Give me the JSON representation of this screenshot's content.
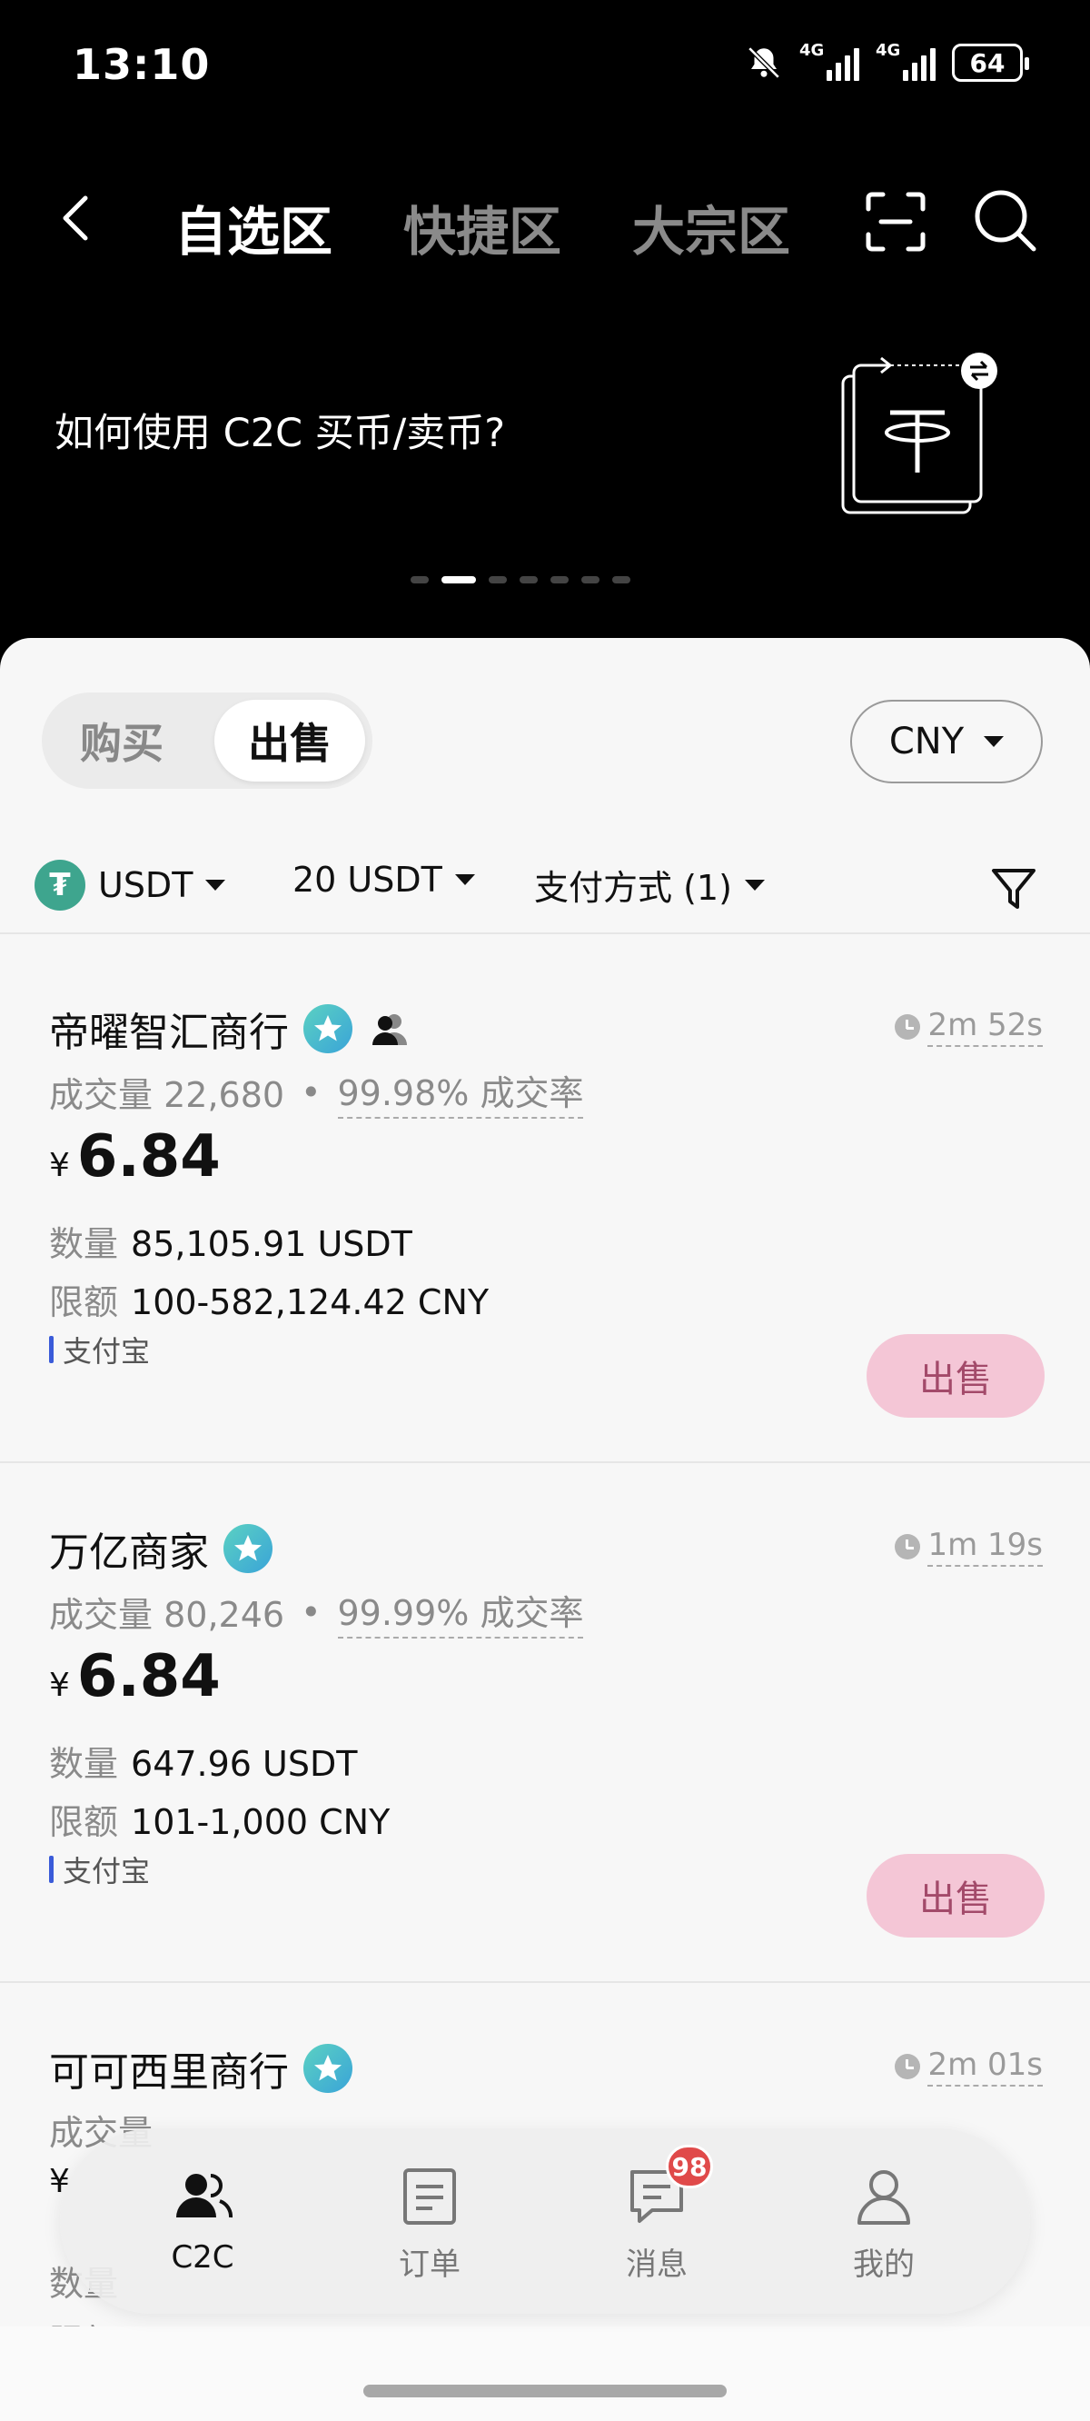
{
  "status_bar": {
    "time": "13:10",
    "network1": "4G",
    "network2": "4G",
    "battery": "64"
  },
  "header": {
    "tabs": [
      {
        "label": "自选区",
        "active": true
      },
      {
        "label": "快捷区",
        "active": false
      },
      {
        "label": "大宗区",
        "active": false
      }
    ]
  },
  "banner": {
    "text": "如何使用 C2C 买币/卖币?",
    "page_count": 7,
    "active_page": 2
  },
  "trade_toggle": {
    "buy": "购买",
    "sell": "出售",
    "selected": "sell"
  },
  "currency": {
    "value": "CNY"
  },
  "filters": {
    "coin": "USDT",
    "coin_symbol": "₮",
    "amount": "20 USDT",
    "payment": "支付方式 (1)"
  },
  "listings": [
    {
      "merchant": "帝曜智汇商行",
      "timer": "2m 52s",
      "volume_label": "成交量",
      "volume": "22,680",
      "rate": "99.98% 成交率",
      "currency_symbol": "¥",
      "price": "6.84",
      "qty_label": "数量",
      "qty": "85,105.91 USDT",
      "limit_label": "限额",
      "limit": "100-582,124.42 CNY",
      "payment": "支付宝",
      "action": "出售"
    },
    {
      "merchant": "万亿商家",
      "timer": "1m 19s",
      "volume_label": "成交量",
      "volume": "80,246",
      "rate": "99.99% 成交率",
      "currency_symbol": "¥",
      "price": "6.84",
      "qty_label": "数量",
      "qty": "647.96 USDT",
      "limit_label": "限额",
      "limit": "101-1,000 CNY",
      "payment": "支付宝",
      "action": "出售"
    },
    {
      "merchant": "可可西里商行",
      "timer": "2m 01s",
      "volume_label": "成交量",
      "volume": "",
      "rate": "",
      "currency_symbol": "¥",
      "price": "",
      "qty_label": "数量",
      "qty": "",
      "limit_label": "限额",
      "limit": "",
      "payment": "",
      "action": ""
    }
  ],
  "bottom_nav": [
    {
      "label": "C2C",
      "active": true
    },
    {
      "label": "订单",
      "active": false
    },
    {
      "label": "消息",
      "active": false,
      "badge": "98"
    },
    {
      "label": "我的",
      "active": false
    }
  ]
}
